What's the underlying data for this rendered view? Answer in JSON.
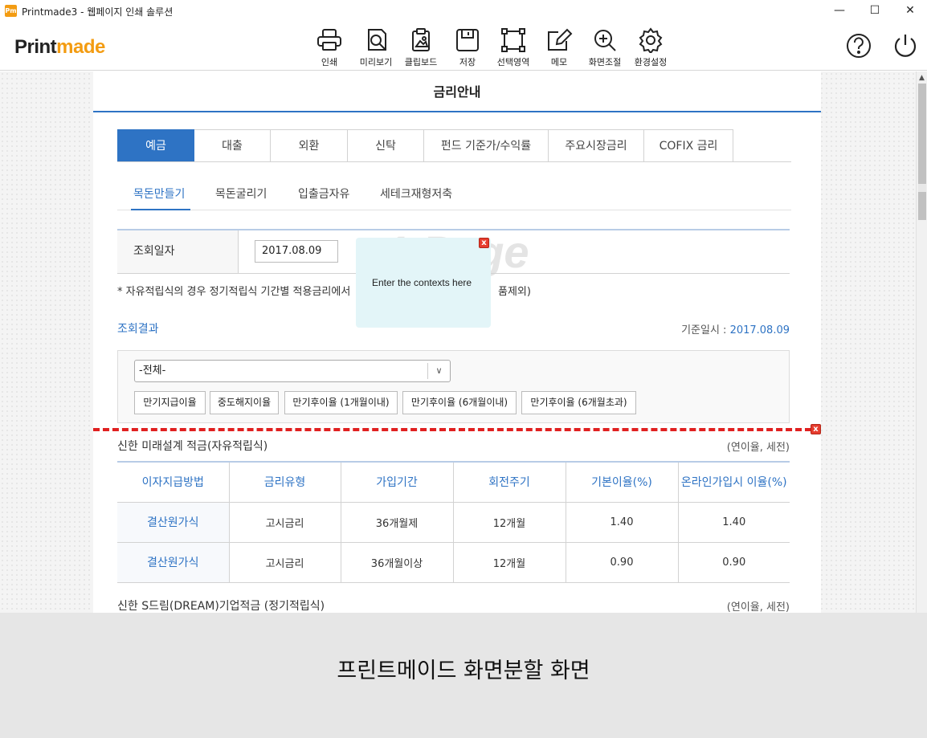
{
  "window": {
    "app_icon_text": "Pm",
    "title": "Printmade3 - 웹페이지 인쇄 솔루션",
    "minimize": "—",
    "maximize": "☐",
    "close": "✕"
  },
  "toolbar": {
    "brand_part1": "Print",
    "brand_part2": "made",
    "tools": [
      {
        "label": "인쇄",
        "icon": "printer-icon"
      },
      {
        "label": "미리보기",
        "icon": "preview-icon"
      },
      {
        "label": "클립보드",
        "icon": "clipboard-icon"
      },
      {
        "label": "저장",
        "icon": "save-icon"
      },
      {
        "label": "선택영역",
        "icon": "select-area-icon"
      },
      {
        "label": "메모",
        "icon": "memo-icon"
      },
      {
        "label": "화면조절",
        "icon": "zoom-icon"
      },
      {
        "label": "환경설정",
        "icon": "gear-icon"
      }
    ],
    "help_icon": "help-icon",
    "power_icon": "power-icon"
  },
  "page": {
    "heading": "금리안내",
    "tabs": [
      "예금",
      "대출",
      "외환",
      "신탁",
      "펀드 기준가/수익률",
      "주요시장금리",
      "COFIX 금리"
    ],
    "active_tab": "예금",
    "subtabs": [
      "목돈만들기",
      "목돈굴리기",
      "입출금자유",
      "세테크재형저축"
    ],
    "active_subtab": "목돈만들기",
    "date_label": "조회일자",
    "date_value": "2017.08.09",
    "note": "* 자유적립식의 경우 정기적립식 기간별 적용금리에서",
    "note_tail": "품제외)",
    "result_label": "조회결과",
    "base_date_label": "기준일시 :",
    "base_date_value": "2017.08.09",
    "select_value": "-전체-",
    "filter_buttons": [
      "만기지급이율",
      "중도해지이율",
      "만기후이율 (1개월이내)",
      "만기후이율 (6개월이내)",
      "만기후이율 (6개월초과)"
    ],
    "section1_title": "신한 미래설계 적금(자유적립식)",
    "section1_note": "(연이율, 세전)",
    "table_headers": [
      "이자지급방법",
      "금리유형",
      "가입기간",
      "회전주기",
      "기본이율(%)",
      "온라인가입시 이율(%)"
    ],
    "table_rows": [
      [
        "결산원가식",
        "고시금리",
        "36개월제",
        "12개월",
        "1.40",
        "1.40"
      ],
      [
        "결산원가식",
        "고시금리",
        "36개월이상",
        "12개월",
        "0.90",
        "0.90"
      ]
    ],
    "section2_title": "신한 S드림(DREAM)기업적금 (정기적립식)",
    "section2_note": "(연이율, 세전)"
  },
  "memo": {
    "text": "Enter the contexts here",
    "watermark": "1 Page",
    "close": "x"
  },
  "cutline_close": "x",
  "caption": "프린트메이드 화면분할 화면"
}
